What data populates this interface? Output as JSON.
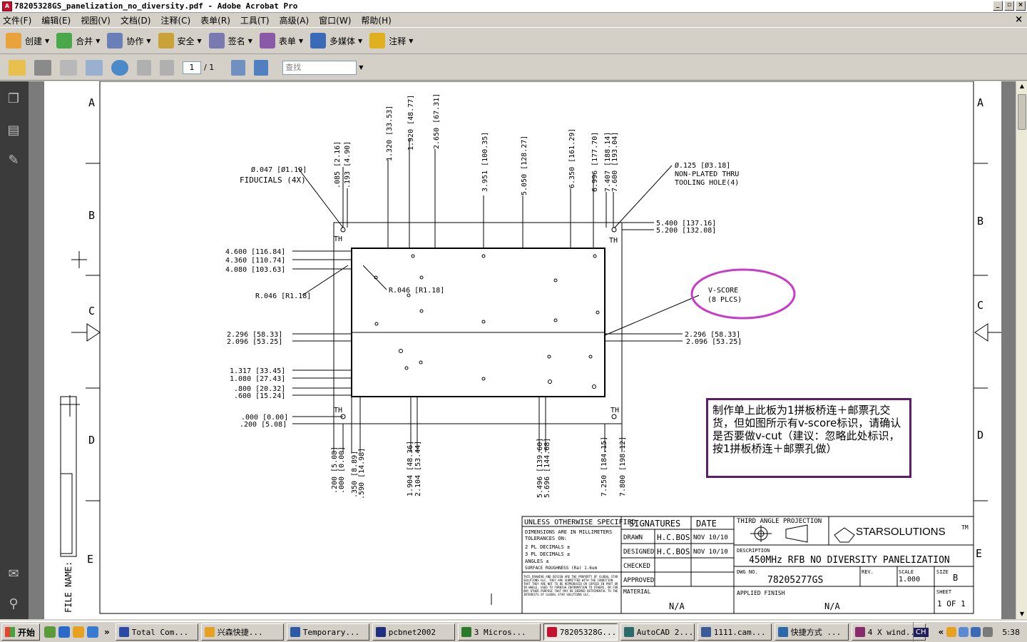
{
  "window": {
    "title": "78205328GS_panelization_no_diversity.pdf - Adobe Acrobat Pro",
    "app_icon": "pdf-icon"
  },
  "menubar": {
    "items": [
      "文件(F)",
      "编辑(E)",
      "视图(V)",
      "文档(D)",
      "注释(C)",
      "表单(R)",
      "工具(T)",
      "高级(A)",
      "窗口(W)",
      "帮助(H)"
    ],
    "close_glyph": "×"
  },
  "toolbar": {
    "buttons": [
      {
        "label": "创建",
        "icon": "create-icon",
        "color": "#e8a33a"
      },
      {
        "label": "合并",
        "icon": "combine-icon",
        "color": "#4aa84a"
      },
      {
        "label": "协作",
        "icon": "collaborate-icon",
        "color": "#6a7fb8"
      },
      {
        "label": "安全",
        "icon": "lock-icon",
        "color": "#c9a23a"
      },
      {
        "label": "签名",
        "icon": "pen-icon",
        "color": "#7a7ab0"
      },
      {
        "label": "表单",
        "icon": "form-icon",
        "color": "#8a5aa8"
      },
      {
        "label": "多媒体",
        "icon": "multimedia-icon",
        "color": "#3a6ab8"
      },
      {
        "label": "注释",
        "icon": "comment-icon",
        "color": "#e0b020"
      }
    ]
  },
  "toolbar2": {
    "page_current": "1",
    "page_total": "/ 1",
    "find_placeholder": "查找"
  },
  "drawing": {
    "row_labels": [
      "A",
      "B",
      "C",
      "D",
      "E"
    ],
    "file_name_label": "FILE NAME:",
    "fiducials": [
      "Ø.047 [Ø1.19]",
      "FIDUCIALS (4X)"
    ],
    "tooling_hole": [
      "Ø.125 [Ø3.18]",
      "NON-PLATED THRU",
      "TOOLING HOLE(4)"
    ],
    "vscore": [
      "V-SCORE",
      "(8 PLCS)"
    ],
    "radius_left": "R.046 [R1.18]",
    "radius_right": "R.046 [R1.18]",
    "top_dims": [
      ".085 [2.16]",
      ".193 [4.90]",
      "1.320 [33.53]",
      "1.920 [48.77]",
      "2.650 [67.31]",
      "3.951 [100.35]",
      "5.050 [128.27]",
      "6.350 [161.29]",
      "6.996 [177.70]",
      "7.407 [188.14]",
      "7.600 [193.04]"
    ],
    "left_dims": [
      "4.600 [116.84]",
      "4.360 [110.74]",
      "4.080 [103.63]",
      "2.296 [58.33]",
      "2.096 [53.25]",
      "1.317 [33.45]",
      "1.080 [27.43]",
      ".800 [20.32]",
      ".600 [15.24]",
      ".000 [0.00]",
      ".200 [5.08]"
    ],
    "right_dims": [
      "5.400 [137.16]",
      "5.200 [132.08]",
      "2.296 [58.33]",
      "2.096 [53.25]"
    ],
    "bottom_dims": [
      ".200 [5.08]",
      ".000 [0.00]",
      ".350 [8.89]",
      ".590 [14.98]",
      "1.904 [48.36]",
      "2.104 [53.44]",
      "5.496 [139.60]",
      "5.696 [144.68]",
      "7.250 [184.15]",
      "7.800 [198.12]"
    ],
    "th": "TH"
  },
  "note": {
    "text": "制作单上此板为1拼板桥连＋邮票孔交货，但如图所示有v-score标识，请确认是否要做v-cut（建议：忽略此处标识，按1拼板桥连＋邮票孔做）"
  },
  "title_block": {
    "unless": "UNLESS OTHERWISE SPECIFIED",
    "dims_mm": "DIMENSIONS ARE IN MILLIMETERS",
    "tolerances": "TOLERANCES ON:",
    "pl2": "2 PL DECIMALS ±",
    "pl3": "3 PL DECIMALS ±",
    "angles": "ANGLES ±",
    "surface": "SURFACE ROUGHNESS (Ra) 1.6um",
    "disclaimer": "THIS DRAWING AND DESIGN ARE THE PROPERTY OF GLOBAL STAR SOLUTIONS ULC. THEY ARE SUBMITTED WITH THE CONDITION THAT THEY ARE NOT TO BE REPRODUCED OR COPIED IN PART OR IN WHOLE, USED TO FURNISH INFORMATION TO OTHERS, OR FOR ANY OTHER PURPOSE THAT MAY BE DEEMED DETRIMENTAL TO THE INTERESTS OF GLOBAL STAR SOLUTIONS ULC.",
    "signatures": "SIGNATURES",
    "date": "DATE",
    "drawn": "DRAWN",
    "designed": "DESIGNED",
    "checked": "CHECKED",
    "approved": "APPROVED",
    "drawn_by": "H.C.BOS",
    "designed_by": "H.C.BOS",
    "drawn_date": "NOV 10/10",
    "designed_date": "NOV 10/10",
    "material_label": "MATERIAL",
    "material": "N/A",
    "projection": "THIRD ANGLE PROJECTION",
    "logo": "STARSOLUTIONS",
    "tm": "TM",
    "description_label": "DESCRIPTION",
    "description": "450MHz RFB NO DIVERSITY   PANELIZATION",
    "dwg_label": "DWG NO.",
    "dwg_no": "78205277GS",
    "rev_label": "REV.",
    "scale_label": "SCALE",
    "scale": "1.000",
    "size_label": "SIZE",
    "size": "B",
    "finish_label": "APPLIED FINISH",
    "finish": "N/A",
    "sheet_label": "SHEET",
    "sheet": "1 OF 1"
  },
  "taskbar": {
    "start": "开始",
    "items": [
      {
        "label": "Total Com...",
        "color": "#2a4aa8"
      },
      {
        "label": "兴森快捷...",
        "color": "#e8a020"
      },
      {
        "label": "Temporary...",
        "color": "#2a5aa8"
      },
      {
        "label": "pcbnet2002",
        "color": "#203080"
      },
      {
        "label": "3 Micros...",
        "color": "#2a7a2a"
      },
      {
        "label": "78205328G...",
        "color": "#c8102e"
      },
      {
        "label": "AutoCAD 2...",
        "color": "#2a6a6a"
      },
      {
        "label": "1111.cam...",
        "color": "#3a5a9a"
      },
      {
        "label": "快捷方式 ...",
        "color": "#2a6aa8"
      },
      {
        "label": "4 X wind...",
        "color": "#8a2a6a"
      }
    ],
    "lang": "CH",
    "clock": "5:38",
    "chevron": "»",
    "tray_chevron": "«"
  }
}
